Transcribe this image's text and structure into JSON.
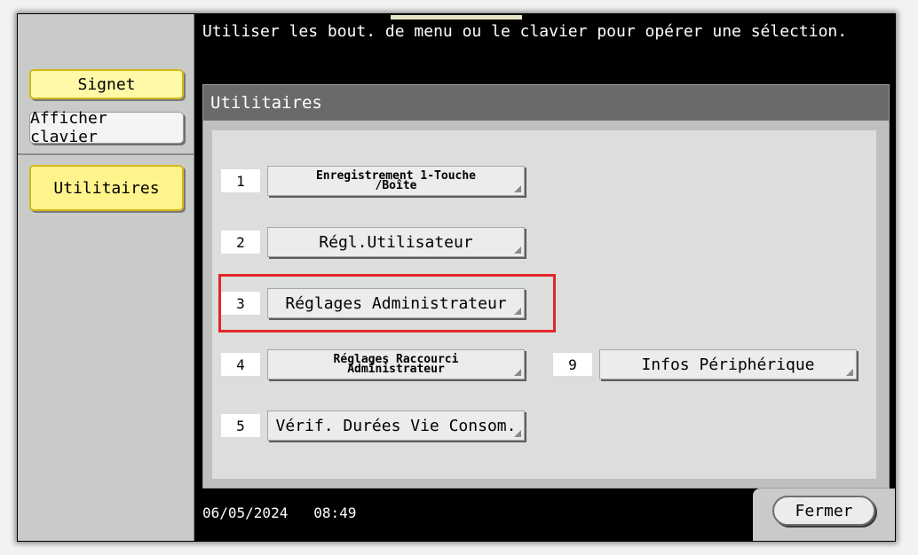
{
  "message": "Utiliser les bout. de menu ou le clavier pour opérer une sélection.",
  "top_indicator": "<<♦>>",
  "sidebar": {
    "signet": "Signet",
    "keyboard": "Afficher clavier",
    "utilities": "Utilitaires"
  },
  "panel": {
    "title": "Utilitaires",
    "items": [
      {
        "num": "1",
        "label": "Enregistrement 1-Touche /Boîte"
      },
      {
        "num": "2",
        "label": "Régl.Utilisateur"
      },
      {
        "num": "3",
        "label": "Réglages Administrateur"
      },
      {
        "num": "4",
        "label": "Réglages Raccourci Administrateur"
      },
      {
        "num": "5",
        "label": "Vérif. Durées Vie Consom."
      },
      {
        "num": "9",
        "label": "Infos Périphérique"
      }
    ]
  },
  "status": {
    "date": "06/05/2024",
    "time": "08:49"
  },
  "close_label": "Fermer",
  "colors": {
    "highlight": "#e3262b",
    "selected_bg": "#fff48c",
    "panel_header": "#6a6a6a"
  }
}
